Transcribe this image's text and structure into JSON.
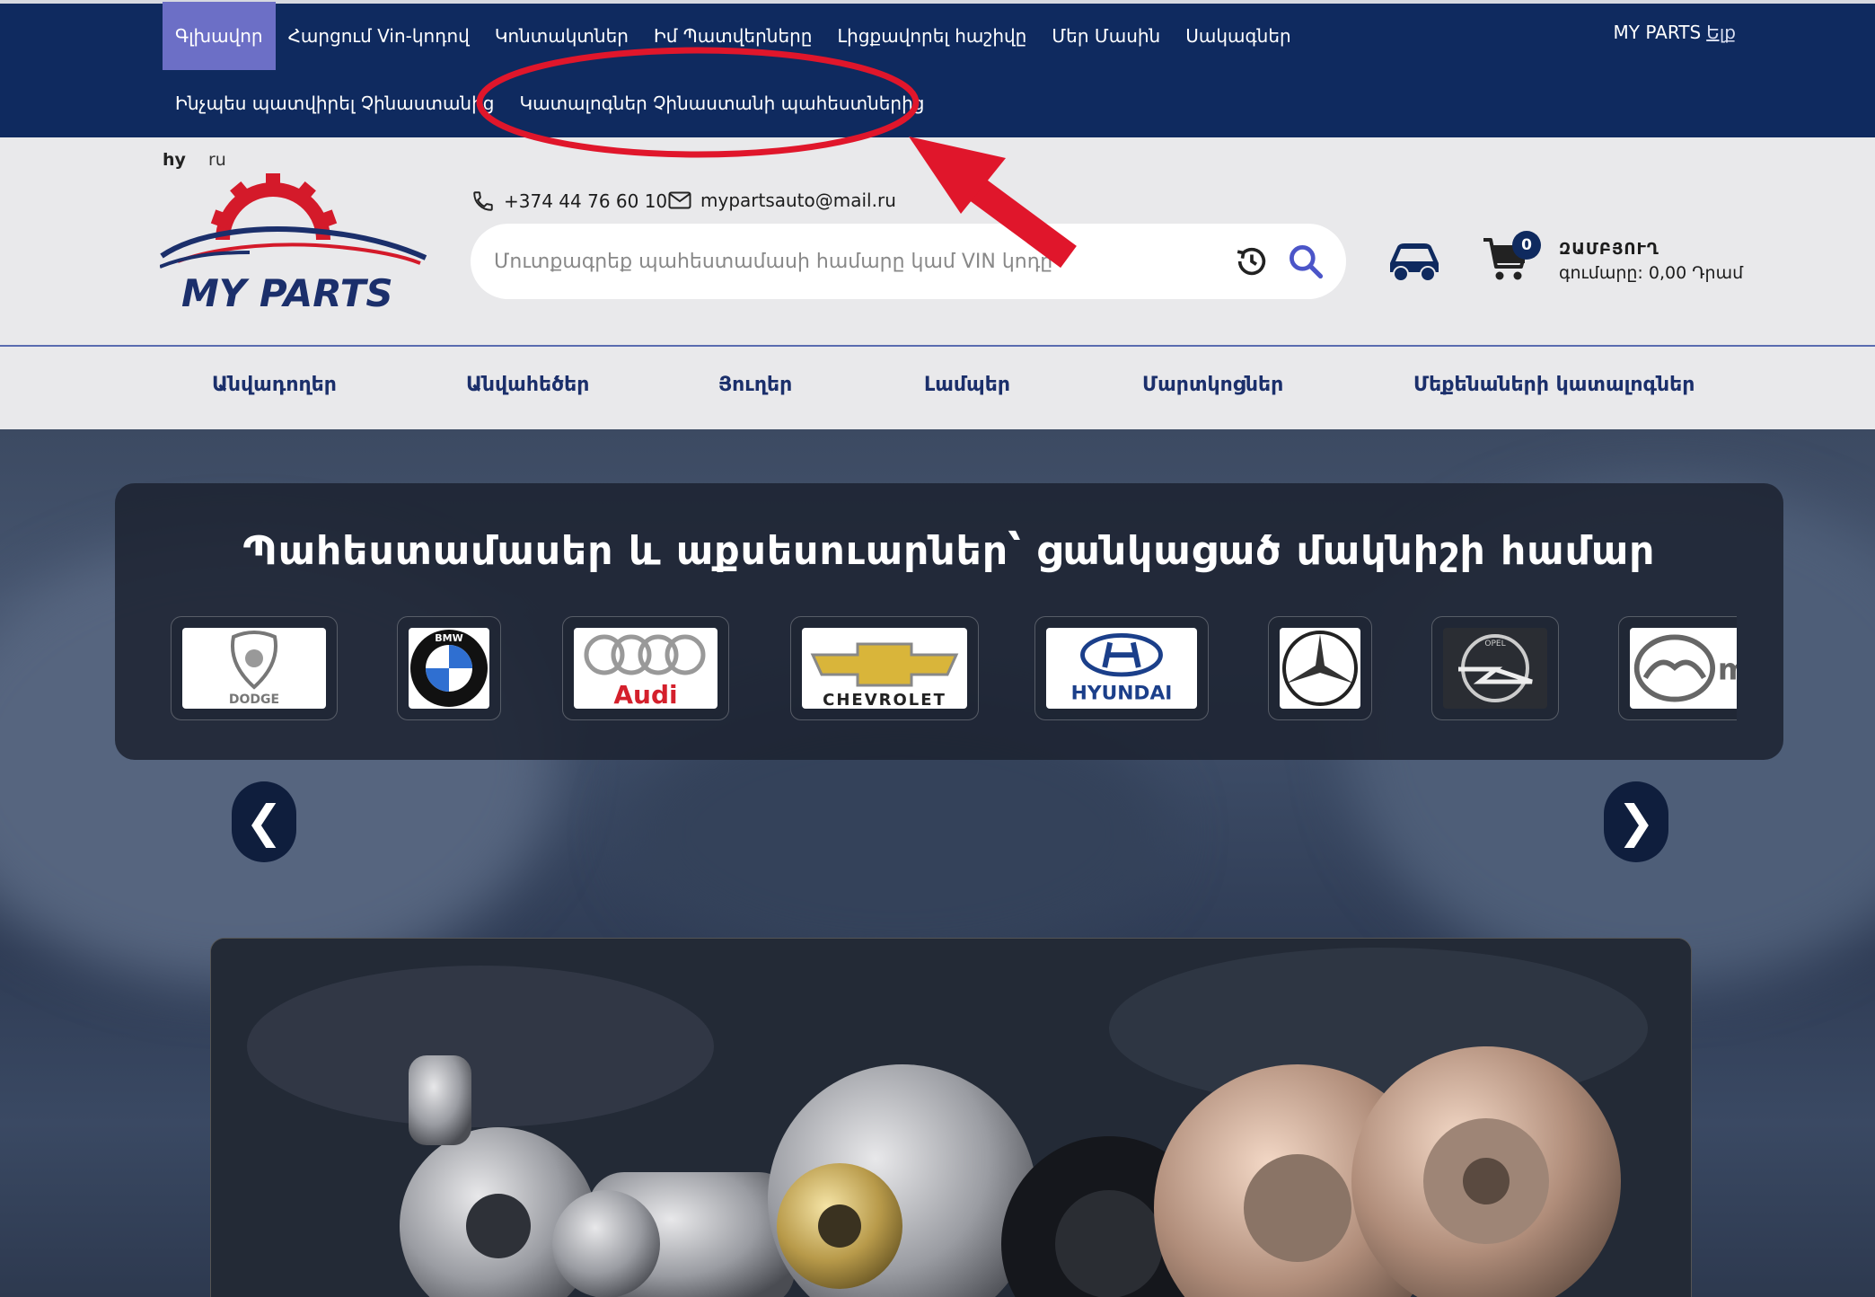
{
  "topnav": {
    "row1": [
      "Գլխավոր",
      "Հարցում Vin-կոդով",
      "Կոնտակտներ",
      "Իմ Պատվերները",
      "Լիցքավորել հաշիվը",
      "Մեր Մասին",
      "Սակագներ"
    ],
    "row2": [
      "Ինչպես պատվիրել Չինաստանից",
      "Կատալոգներ Չինաստանի պահեստներից"
    ],
    "account_name": "MY PARTS",
    "logout": "Ելք"
  },
  "header": {
    "langs": [
      "hy",
      "ru"
    ],
    "logo_text": "MY PARTS",
    "phone": "+374 44 76 60 10",
    "email": "mypartsauto@mail.ru",
    "search_placeholder": "Մուտքագրեք պահեստամասի համարը կամ VIN կոդը",
    "cart_count": "0",
    "cart_title": "ԶԱՄԲՅՈՒՂ",
    "cart_sum": "գումարը: 0,00 Դրամ"
  },
  "categories": [
    "Անվադողեր",
    "Անվահեծեր",
    "Յուղեր",
    "Լամպեր",
    "Մարտկոցներ",
    "Մեքենաների կատալոգներ"
  ],
  "hero": {
    "title": "Պահեստամասեր և աքսեսուարներ՝ ցանկացած մակնիշի համար",
    "brands": [
      "DODGE",
      "BMW",
      "Audi",
      "CHEVROLET",
      "HYUNDAI",
      "Mercedes-Benz",
      "OPEL",
      "mazda"
    ]
  },
  "slider": {
    "prev": "❮",
    "next": "❯"
  },
  "colors": {
    "navy": "#0f2a5f",
    "active": "#6c6fc6",
    "accent_red": "#e0162b"
  }
}
